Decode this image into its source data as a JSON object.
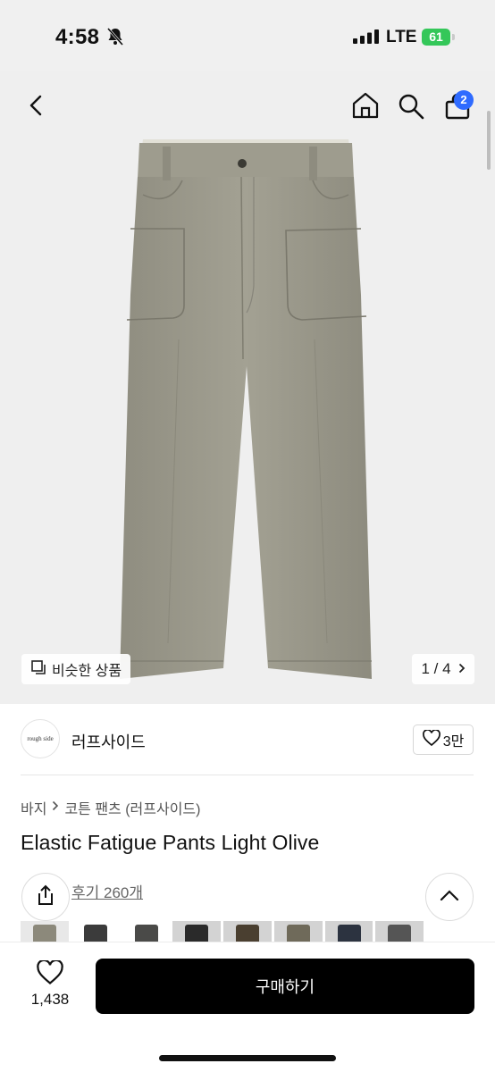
{
  "status": {
    "time": "4:58",
    "network": "LTE",
    "battery": "61"
  },
  "header": {
    "cart_count": "2"
  },
  "gallery": {
    "similar_label": "비슷한 상품",
    "page_indicator": "1 / 4"
  },
  "brand": {
    "name": "러프사이드",
    "logo_text": "rough side",
    "likes": "3만"
  },
  "breadcrumb": {
    "category": "바지",
    "subcategory": "코튼 팬츠 (러프사이드)"
  },
  "product": {
    "title": "Elastic Fatigue Pants Light Olive",
    "reviews": "후기 260개"
  },
  "bottom": {
    "wish_count": "1,438",
    "buy_label": "구매하기"
  },
  "icons": [
    "bell-off-icon",
    "signal-icon",
    "back-icon",
    "home-icon",
    "search-icon",
    "cart-icon",
    "similar-icon",
    "chevron-right-icon",
    "heart-icon",
    "share-icon",
    "chevron-up-icon"
  ],
  "colors": {
    "accent": "#2f6bff",
    "battery": "#34c759",
    "button": "#000000",
    "pants": "#9c9a8c"
  }
}
